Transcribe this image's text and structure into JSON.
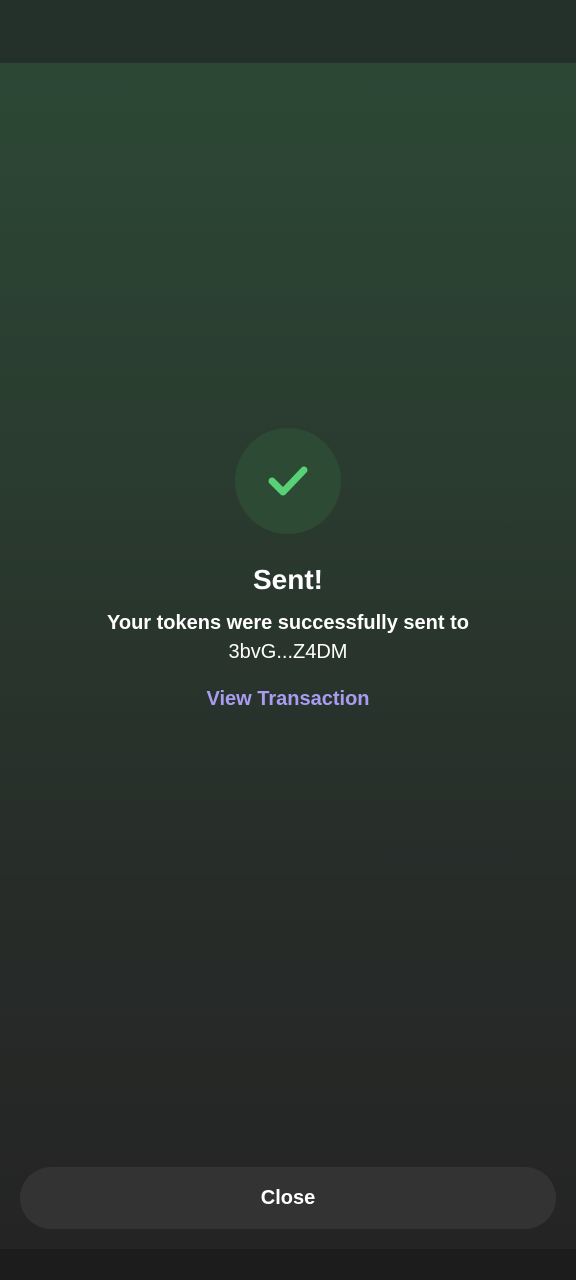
{
  "confirmation": {
    "icon": "checkmark-icon",
    "accent_color": "#58d176",
    "title": "Sent!",
    "message": "Your tokens were successfully sent to",
    "address": "3bvG...Z4DM",
    "view_transaction_label": "View Transaction",
    "link_color": "#a99cf0"
  },
  "footer": {
    "close_label": "Close"
  }
}
